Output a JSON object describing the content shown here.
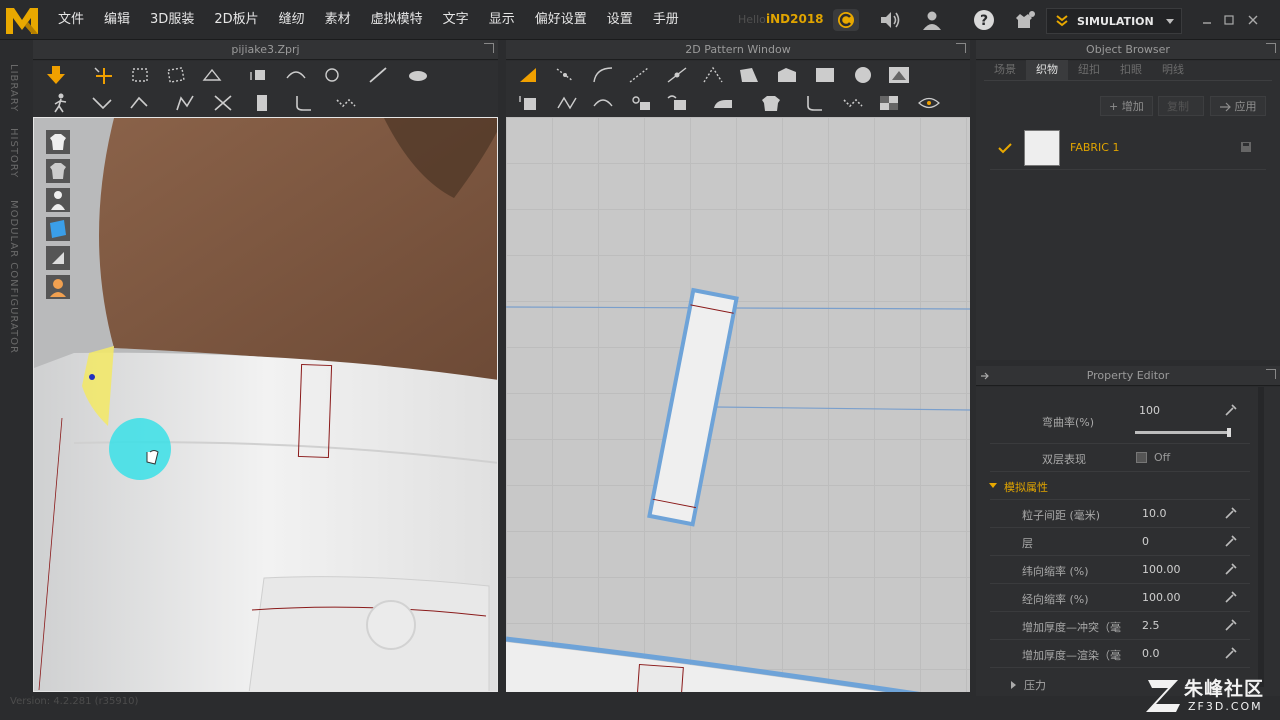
{
  "menubar": {
    "items": [
      "文件",
      "编辑",
      "3D服装",
      "2D板片",
      "缝纫",
      "素材",
      "虚拟模特",
      "文字",
      "显示",
      "偏好设置",
      "设置",
      "手册"
    ],
    "hello": "Hello",
    "username": "iND2018",
    "mode_label": "SIMULATION"
  },
  "panels": {
    "view3d_title": "pijiake3.Zprj",
    "view2d_title": "2D Pattern Window",
    "object_browser_title": "Object Browser",
    "property_editor_title": "Property Editor"
  },
  "side_tabs": [
    "LIBRARY",
    "HISTORY",
    "MODULAR CONFIGURATOR"
  ],
  "object_browser": {
    "tabs": [
      "场景",
      "织物",
      "纽扣",
      "扣眼",
      "明线"
    ],
    "active_tab": 1,
    "add_label": "+ 增加",
    "copy_label": "复制",
    "apply_label": "应用",
    "fabric_name": "FABRIC 1"
  },
  "property_editor": {
    "bend_label": "弯曲率(%)",
    "bend_value": "100",
    "bend_slider_fraction": 0.98,
    "double_layer_label": "双层表现",
    "double_layer_value": "Off",
    "section_label": "模拟属性",
    "rows": [
      {
        "label": "粒子间距 (毫米)",
        "value": "10.0"
      },
      {
        "label": "层",
        "value": "0"
      },
      {
        "label": "纬向缩率 (%)",
        "value": "100.00"
      },
      {
        "label": "经向缩率 (%)",
        "value": "100.00"
      },
      {
        "label": "增加厚度—冲突（毫",
        "value": "2.5"
      },
      {
        "label": "增加厚度—渲染（毫",
        "value": "0.0"
      }
    ],
    "collapsed_label": "压力"
  },
  "status": {
    "version": "Version: 4.2.281 (r35910)"
  },
  "watermark": {
    "text": "朱峰社区",
    "url": "ZF3D.COM"
  },
  "colors": {
    "accent": "#e0a400",
    "pattern_outline": "#6ea3d8",
    "cursor_circle": "#39e0e8"
  }
}
